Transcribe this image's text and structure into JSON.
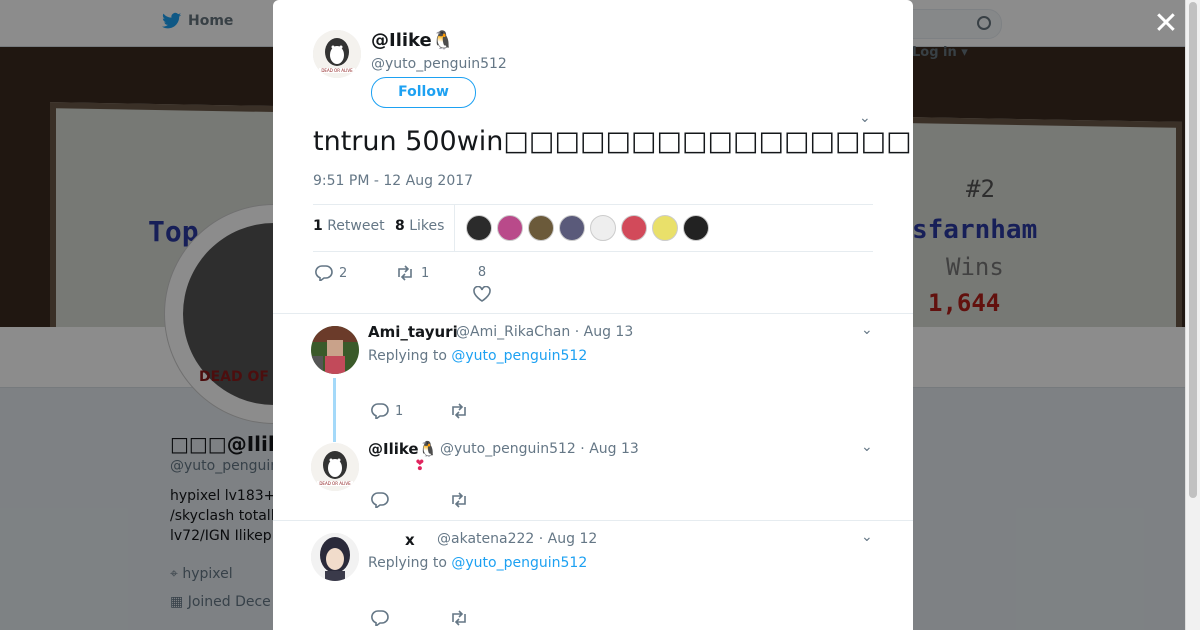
{
  "background": {
    "nav": {
      "home_label": "Home",
      "login_label": "Log in"
    },
    "banner": {
      "title_left": "Top Doul",
      "rank": "#2",
      "title_right": "sfarnham",
      "wins_label": "Wins",
      "wins_value": "1,644"
    },
    "avatar_label": "DEAD OF",
    "profile": {
      "name": "□□□@Ilike",
      "handle": "@yuto_penguin",
      "bio_lines": [
        "hypixel lv183+",
        "/skyclash totall",
        "lv72/IGN Ilikep"
      ],
      "location": "hypixel",
      "joined": "Joined Dece"
    }
  },
  "modal": {
    "close_glyph": "✕",
    "author": {
      "name": "@Ilike🐧",
      "handle": "@yuto_penguin512",
      "follow_label": "Follow"
    },
    "tweet": {
      "text": "tntrun 500win□□□□□□□□□□□□□□□□",
      "datetime": "9:51 PM - 12 Aug 2017",
      "retweets_count": "1",
      "retweets_label": "Retweet",
      "likes_count": "8",
      "likes_label": "Likes",
      "liker_colors": [
        "#2b2b2b",
        "#b94a8a",
        "#6b5a3a",
        "#5a5a7a",
        "#eeeeee",
        "#d24a5a",
        "#e9e06a",
        "#222222"
      ]
    },
    "actions": {
      "replies": "2",
      "retweets": "1",
      "likes": "8"
    },
    "replies": [
      {
        "name": "Ami_tayuri",
        "handle": "@Ami_RikaChan",
        "date": "Aug 13",
        "replying_prefix": "Replying to",
        "replying_to": "@yuto_penguin512",
        "replies_count": "1"
      },
      {
        "name": "@Ilike🐧",
        "handle": "@yuto_penguin512",
        "date": "Aug 13",
        "text": "❣"
      },
      {
        "name": "x",
        "handle": "@akatena222",
        "date": "Aug 12",
        "replying_prefix": "Replying to",
        "replying_to": "@yuto_penguin512"
      }
    ]
  },
  "colors": {
    "accent": "#1da1f2",
    "muted": "#657786",
    "text": "#14171a",
    "heart": "#e0245e"
  }
}
